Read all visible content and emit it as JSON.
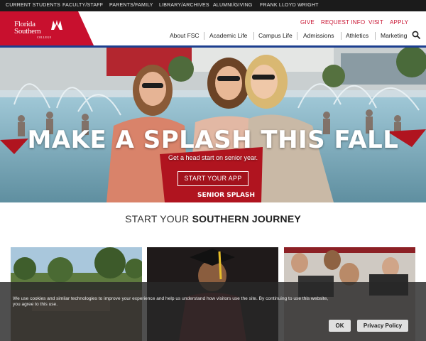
{
  "utility_nav": [
    "CURRENT STUDENTS",
    "FACULTY/STAFF",
    "PARENTS/FAMILY",
    "LIBRARY/ARCHIVES",
    "ALUMNI/GIVING",
    "FRANK LLOYD WRIGHT"
  ],
  "logo": {
    "line1": "Florida",
    "line2": "Southern",
    "line3": "COLLEGE"
  },
  "quick_links": [
    "GIVE",
    "REQUEST INFO",
    "VISIT",
    "APPLY"
  ],
  "main_nav": [
    "About FSC",
    "Academic Life",
    "Campus Life",
    "Admissions",
    "Athletics",
    "Marketing"
  ],
  "hero": {
    "headline": "MAKE A SPLASH THIS FALL",
    "subtext": "Get a head start on senior year.",
    "cta": "START YOUR APP",
    "shirt_text": "SENIOR SPLASH"
  },
  "section": {
    "title_light": "START YOUR ",
    "title_bold": "SOUTHERN JOURNEY"
  },
  "cookie": {
    "text": "We use cookies and similar technologies to improve your experience and help us understand how visitors use the site. By continuing to use this website, you agree to this use.",
    "ok": "OK",
    "privacy": "Privacy Policy"
  },
  "colors": {
    "brand_red": "#c8102e",
    "navy": "#1d3f8f",
    "utility_bg": "#1b1b1b"
  },
  "icons": [
    "search-icon",
    "logo-mark-icon"
  ]
}
